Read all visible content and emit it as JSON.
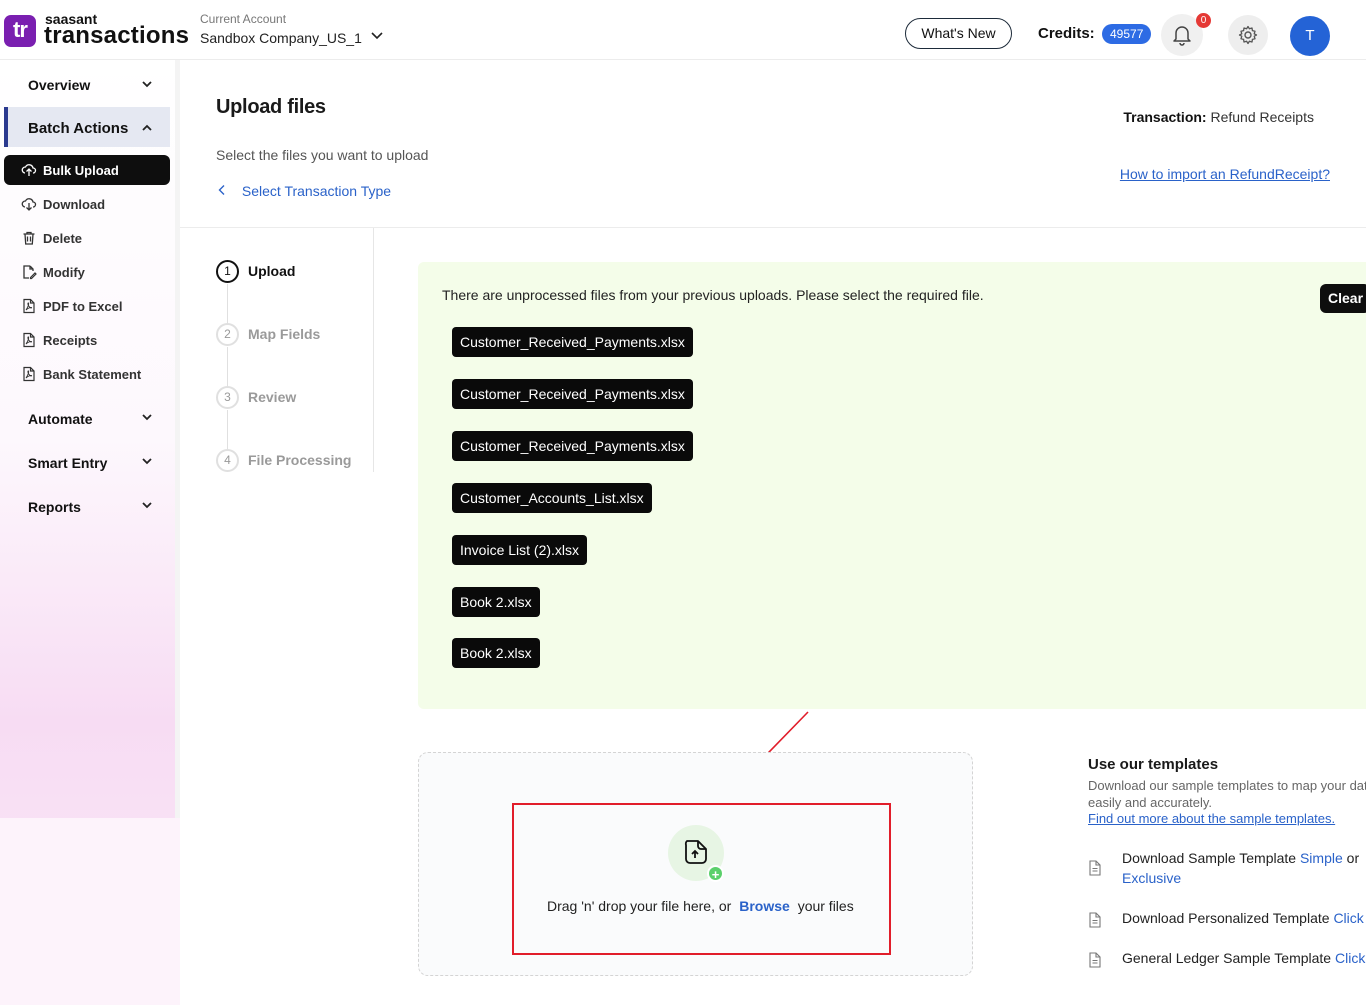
{
  "header": {
    "logo_mark": "tr",
    "logo_small": "saasant",
    "logo_big": "transactions",
    "account_label": "Current Account",
    "account_value": "Sandbox Company_US_1",
    "whats_new": "What's New",
    "credits_label": "Credits:",
    "credits_value": "49577",
    "notifications_count": "0",
    "avatar_initial": "T"
  },
  "sidebar": {
    "overview": "Overview",
    "batch_actions": "Batch Actions",
    "items": [
      {
        "label": "Bulk Upload",
        "icon": "cloud-upload-icon",
        "active": true
      },
      {
        "label": "Download",
        "icon": "cloud-download-icon"
      },
      {
        "label": "Delete",
        "icon": "trash-icon"
      },
      {
        "label": "Modify",
        "icon": "edit-file-icon"
      },
      {
        "label": "PDF to Excel",
        "icon": "pdf-icon"
      },
      {
        "label": "Receipts",
        "icon": "receipt-icon"
      },
      {
        "label": "Bank Statement",
        "icon": "bank-statement-icon"
      }
    ],
    "automate": "Automate",
    "smart_entry": "Smart Entry",
    "reports": "Reports"
  },
  "page": {
    "title": "Upload files",
    "subtitle": "Select the files you want to upload",
    "back_link": "Select Transaction Type",
    "transaction_label": "Transaction:",
    "transaction_value": "Refund Receipts",
    "how_to_link": "How to import an RefundReceipt?"
  },
  "steps": [
    {
      "num": "1",
      "label": "Upload"
    },
    {
      "num": "2",
      "label": "Map Fields"
    },
    {
      "num": "3",
      "label": "Review"
    },
    {
      "num": "4",
      "label": "File Processing"
    }
  ],
  "unprocessed": {
    "message": "There are unprocessed files from your previous uploads. Please select the required file.",
    "clear_label": "Clear",
    "files": [
      "Customer_Received_Payments.xlsx",
      "Customer_Received_Payments.xlsx",
      "Customer_Received_Payments.xlsx",
      "Customer_Accounts_List.xlsx",
      "Invoice List (2).xlsx",
      "Book 2.xlsx",
      "Book 2.xlsx"
    ]
  },
  "dropzone": {
    "text_before": "Drag 'n' drop your file here, or",
    "browse": "Browse",
    "text_after": "your files"
  },
  "templates": {
    "title": "Use our templates",
    "description": "Download our sample templates to map your dat easily and accurately.",
    "learn_more": "Find out more about the sample templates.",
    "row1_text": "Download Sample Template",
    "row1_link1": "Simple",
    "row1_or": "or",
    "row1_link2": "Exclusive",
    "row2_text": "Download Personalized Template",
    "row2_link": "Click H",
    "row3_text": "General Ledger Sample Template",
    "row3_link": "Click H"
  },
  "colors": {
    "accent": "#2a62c9",
    "brand": "#7a1fb0",
    "panel_bg": "#f4fde9",
    "annotation_red": "#e11d2a"
  }
}
